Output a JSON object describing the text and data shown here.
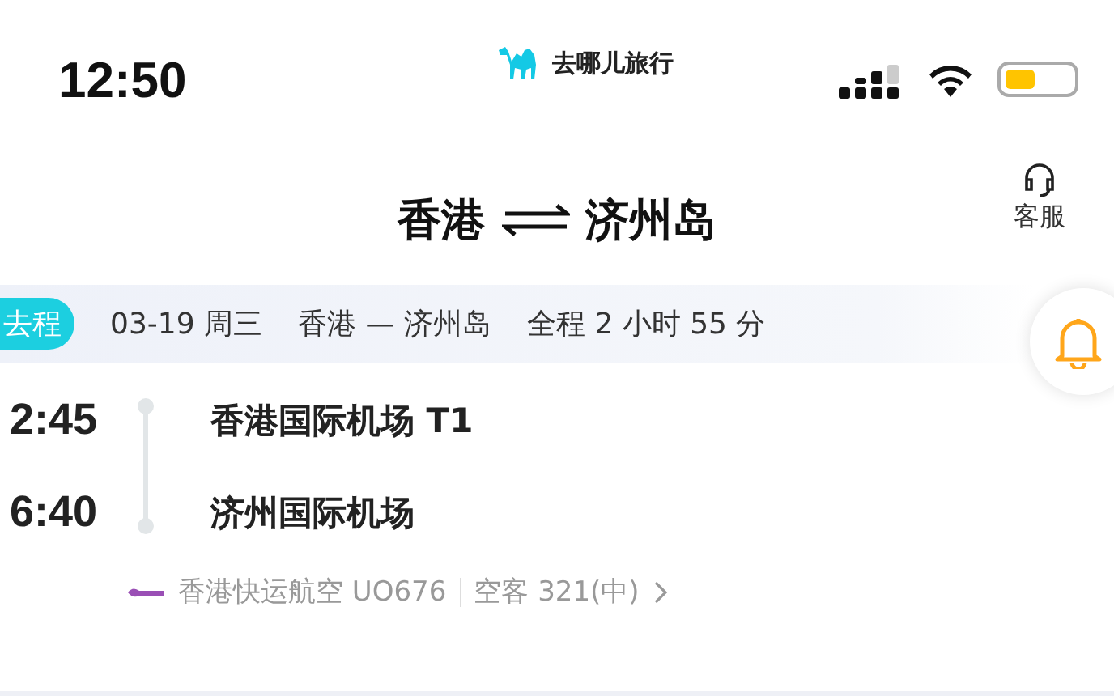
{
  "status_bar": {
    "time": "12:50",
    "brand": "去哪儿旅行"
  },
  "header": {
    "origin": "香港",
    "destination": "济州岛",
    "service_label": "客服"
  },
  "trip_summary": {
    "tag": "去程",
    "date": "03-19 周三",
    "route": "香港 — 济州岛",
    "duration": "全程 2 小时 55 分"
  },
  "flight": {
    "stops": [
      {
        "time": "2:45",
        "airport": "香港国际机场 T1"
      },
      {
        "time": "6:40",
        "airport": "济州国际机场"
      }
    ],
    "airline": "香港快运航空 UO676",
    "aircraft": "空客 321(中)"
  }
}
